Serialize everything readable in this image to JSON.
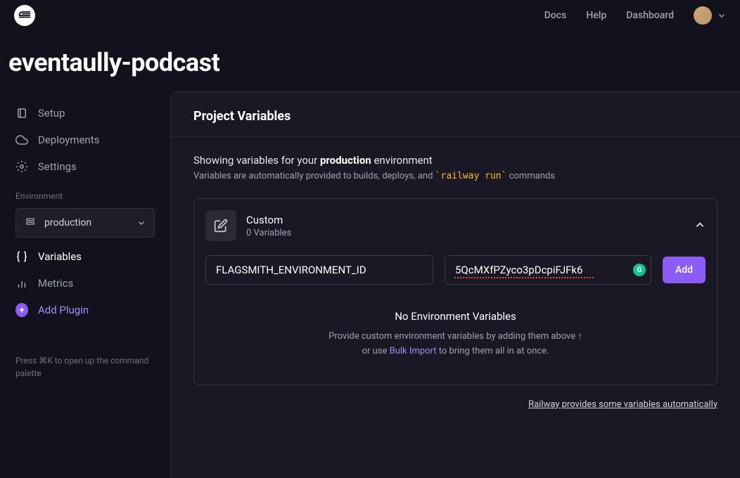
{
  "header": {
    "links": {
      "docs": "Docs",
      "help": "Help",
      "dashboard": "Dashboard"
    }
  },
  "page": {
    "title": "eventaully-podcast"
  },
  "sidebar": {
    "setup": "Setup",
    "deployments": "Deployments",
    "settings": "Settings",
    "env_label": "Environment",
    "env_value": "production",
    "variables": "Variables",
    "metrics": "Metrics",
    "add_plugin": "Add Plugin",
    "hint": "Press ⌘K to open up the command palette"
  },
  "content": {
    "title": "Project Variables",
    "subtitle_prefix": "Showing variables for your ",
    "subtitle_bold": "production",
    "subtitle_suffix": " environment",
    "desc_prefix": "Variables are automatically provided to builds, deploys, and ",
    "desc_code": "`railway run`",
    "desc_suffix": " commands"
  },
  "card": {
    "title": "Custom",
    "subtitle": "0 Variables",
    "key_input": "FLAGSMITH_ENVIRONMENT_ID",
    "value_input": "5QcMXfPZyco3pDcpiFJFk6",
    "add_btn": "Add"
  },
  "empty": {
    "title": "No Environment Variables",
    "line1_prefix": "Provide custom environment variables by adding them above ↑",
    "line2_prefix": "or use ",
    "line2_link": "Bulk Import",
    "line2_suffix": " to bring them all in at once."
  },
  "footer_link": "Railway provides some variables automatically"
}
